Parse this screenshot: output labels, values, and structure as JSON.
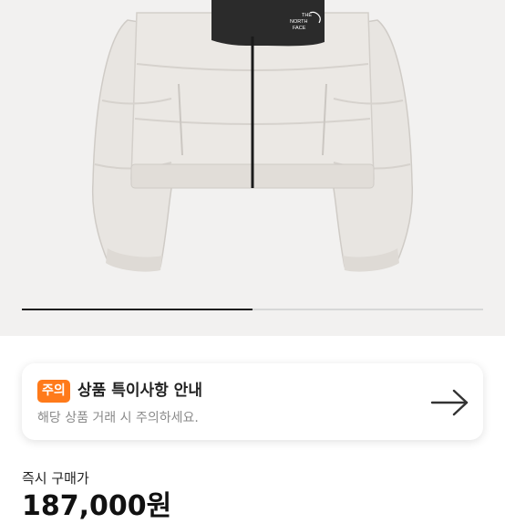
{
  "product": {
    "brand_logo_lines": [
      "THE",
      "NORTH",
      "FACE"
    ],
    "image_alt": "cropped puffer jacket"
  },
  "carousel": {
    "active_fraction": 0.5
  },
  "notice": {
    "badge": "주의",
    "title": "상품 특이사항 안내",
    "subtitle": "해당 상품 거래 시 주의하세요.",
    "arrow_icon": "arrow-right-icon"
  },
  "purchase": {
    "label": "즉시 구매가",
    "price": "187,000원"
  },
  "colors": {
    "accent": "#ff7a1a",
    "image_background": "#f2f1f0",
    "jacket_body": "#e9e6e2",
    "yoke": "#2a2a2a"
  }
}
